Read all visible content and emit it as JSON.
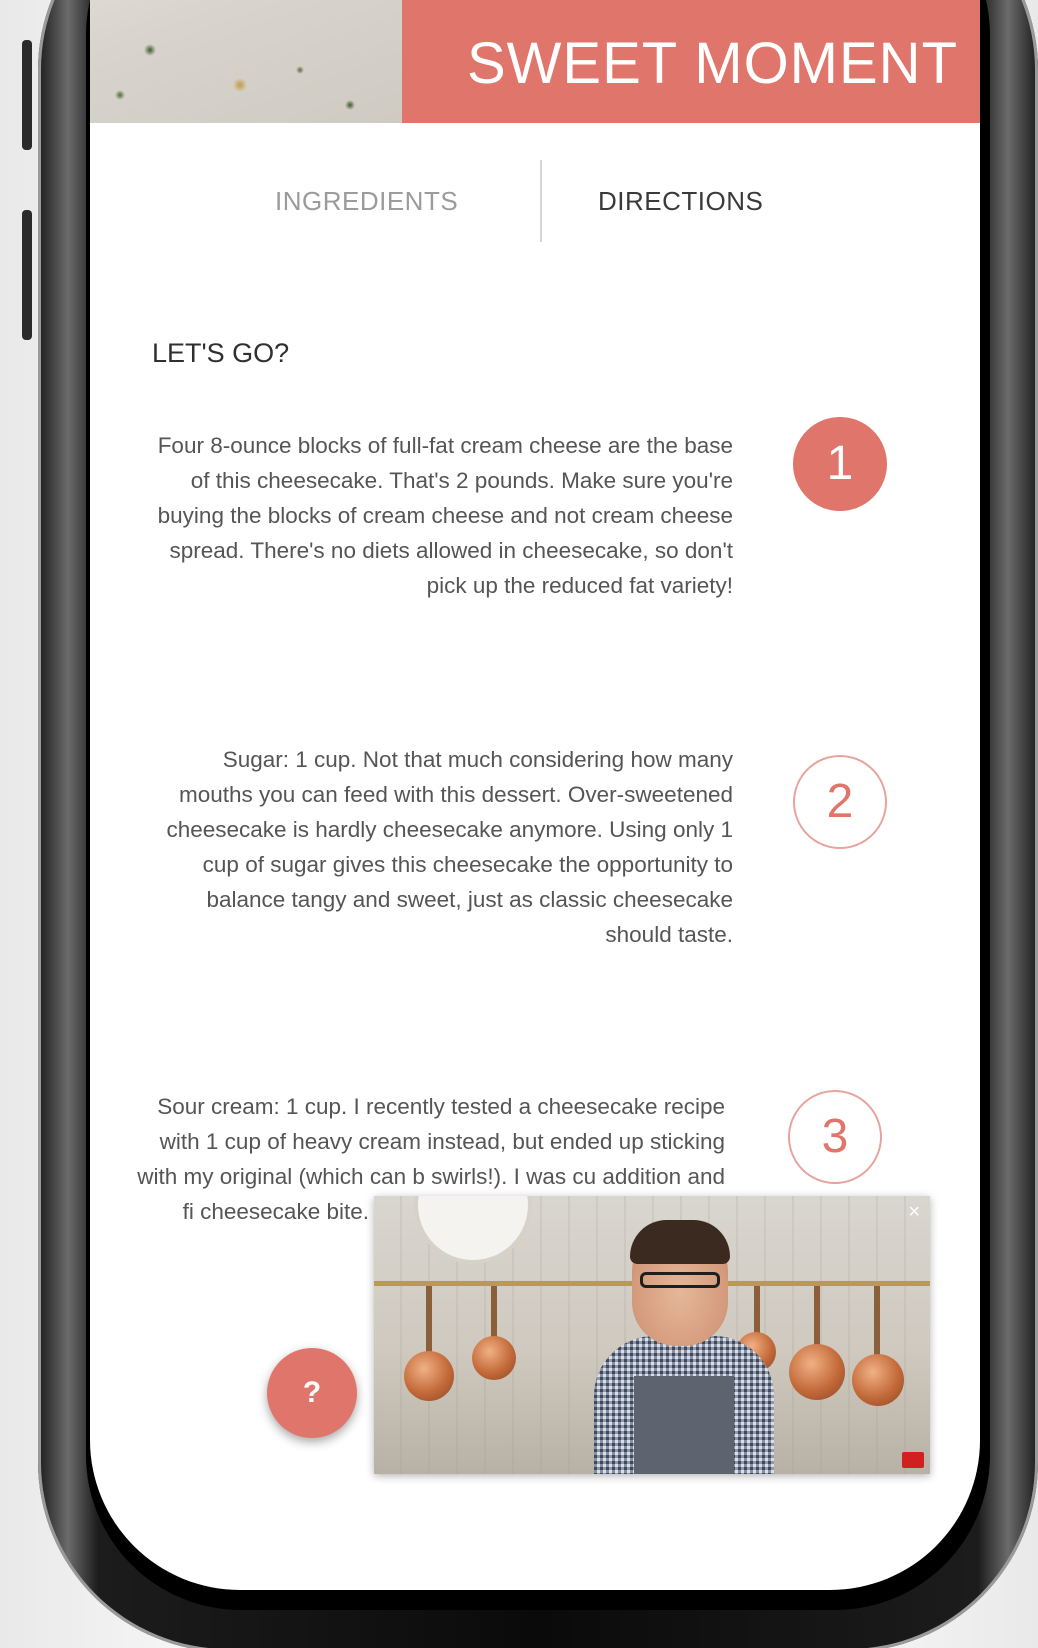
{
  "hero": {
    "title": "SWEET MOMENT"
  },
  "tabs": [
    {
      "label": "INGREDIENTS",
      "active": false
    },
    {
      "label": "DIRECTIONS",
      "active": true
    }
  ],
  "section_title": "LET'S GO?",
  "steps": [
    {
      "number": "1",
      "style": "filled",
      "text": "Four 8-ounce blocks of full-fat cream cheese are the base of this cheesecake. That's 2 pounds. Make sure you're buying the blocks of cream cheese and not cream cheese spread. There's no diets allowed in cheesecake, so don't pick up the reduced fat variety!"
    },
    {
      "number": "2",
      "style": "outlined",
      "text": "Sugar: 1 cup. Not that much considering how many mouths you can feed with this dessert. Over-sweetened cheesecake is hardly cheesecake anymore. Using only 1 cup of sugar gives this cheesecake the opportunity to balance tangy and sweet, just as classic cheesecake should taste."
    },
    {
      "number": "3",
      "style": "outlined",
      "text": "Sour cream: 1 cup. I recently tested a cheesecake recipe with 1 cup of heavy cream instead, but ended up sticking with my original (which can b swirls!). I was cu addition and fi cheesecake bite. Th lacked the stabil was almost too"
    }
  ],
  "video": {
    "close_icon": "×"
  },
  "help_button": {
    "label": "?"
  },
  "colors": {
    "accent": "#e0756b"
  }
}
